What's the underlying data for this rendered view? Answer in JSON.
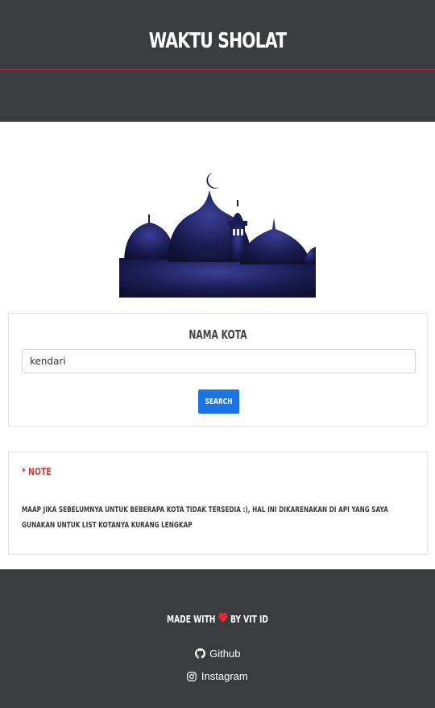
{
  "header": {
    "title": "Waktu Sholat"
  },
  "search_card": {
    "title": "Nama Kota",
    "input_value": "kendari",
    "button_label": "Search"
  },
  "note_card": {
    "title": "* Note",
    "text": "Maap jika sebelumnya untuk beberapa kota tidak tersedia :), hal ini dikarenakan di API yang saya gunakan untuk list kotanya kurang lengkap"
  },
  "footer": {
    "made_with": "Made with",
    "by": "by Vit ID",
    "links": [
      {
        "label": "Github",
        "icon": "github-icon"
      },
      {
        "label": "Instagram",
        "icon": "instagram-icon"
      }
    ]
  },
  "colors": {
    "header_bg": "#3b3c3e",
    "accent_line": "#b7343a",
    "note_red": "#d63c3c",
    "button_blue": "#1b74e4",
    "mosque_navy": "#14143f"
  }
}
